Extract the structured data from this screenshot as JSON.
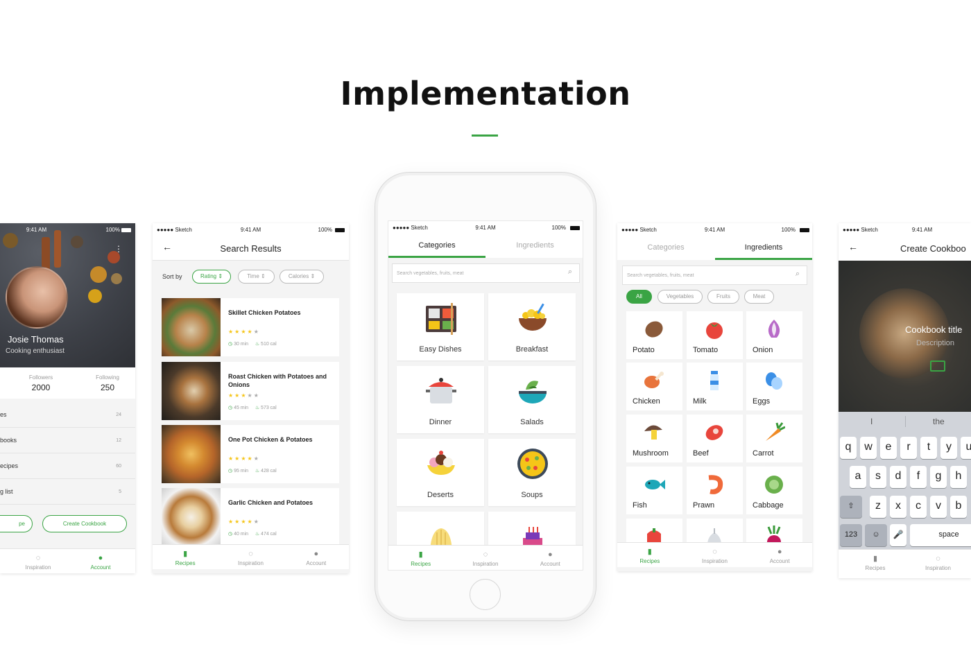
{
  "page": {
    "title": "Implementation"
  },
  "status": {
    "carrier": "●●●●● Sketch",
    "time": "9:41 AM",
    "battery": "100%"
  },
  "tabs": {
    "recipes": "Recipes",
    "inspiration": "Inspiration",
    "account": "Account"
  },
  "profile": {
    "name": "Josie Thomas",
    "subtitle": "Cooking enthusiast",
    "followers_label": "Followers",
    "followers": "2000",
    "following_label": "Following",
    "following": "250",
    "list": [
      {
        "label": "es",
        "count": "24"
      },
      {
        "label": "books",
        "count": "12"
      },
      {
        "label": "ecipes",
        "count": "60"
      },
      {
        "label": "g list",
        "count": "5"
      }
    ],
    "left_button": "pe",
    "create_button": "Create Cookbook"
  },
  "search_results": {
    "title": "Search Results",
    "sort_label": "Sort by",
    "sort_options": [
      "Rating",
      "Time",
      "Calories"
    ],
    "recipes": [
      {
        "title": "Skillet Chicken Potatoes",
        "stars": 4,
        "time": "30 min",
        "cal": "510 cal"
      },
      {
        "title": "Roast Chicken with Potatoes and Onions",
        "stars": 3,
        "time": "45 min",
        "cal": "573 cal"
      },
      {
        "title": "One Pot Chicken & Potatoes",
        "stars": 4,
        "time": "95 min",
        "cal": "428 cal"
      },
      {
        "title": "Garlic Chicken and Potatoes",
        "stars": 4,
        "time": "40 min",
        "cal": "474 cal"
      }
    ]
  },
  "categories_screen": {
    "tab_categories": "Categories",
    "tab_ingredients": "Ingredients",
    "search_placeholder": "Search vegetables, fruits, meat",
    "categories": [
      "Easy Dishes",
      "Breakfast",
      "Dinner",
      "Salads",
      "Deserts",
      "Soups"
    ]
  },
  "ingredients_screen": {
    "tab_categories": "Categories",
    "tab_ingredients": "Ingredients",
    "search_placeholder": "Search vegetables, fruits, meat",
    "filters": [
      "All",
      "Vegetables",
      "Fruits",
      "Meat"
    ],
    "items": [
      "Potato",
      "Tomato",
      "Onion",
      "Chicken",
      "Milk",
      "Eggs",
      "Mushroom",
      "Beef",
      "Carrot",
      "Fish",
      "Prawn",
      "Cabbage"
    ]
  },
  "create_cookbook": {
    "title": "Create Cookboo",
    "cover_title": "Cookbook title",
    "cover_desc": "Description",
    "suggestions": [
      "I",
      "the"
    ],
    "row1": [
      "q",
      "w",
      "e",
      "r",
      "t",
      "y",
      "u"
    ],
    "row2": [
      "a",
      "s",
      "d",
      "f",
      "g",
      "h"
    ],
    "row3": [
      "z",
      "x",
      "c",
      "v",
      "b"
    ],
    "num_key": "123",
    "space_key": "space"
  },
  "colors": {
    "accent": "#3aa444",
    "star": "#f5c518"
  }
}
